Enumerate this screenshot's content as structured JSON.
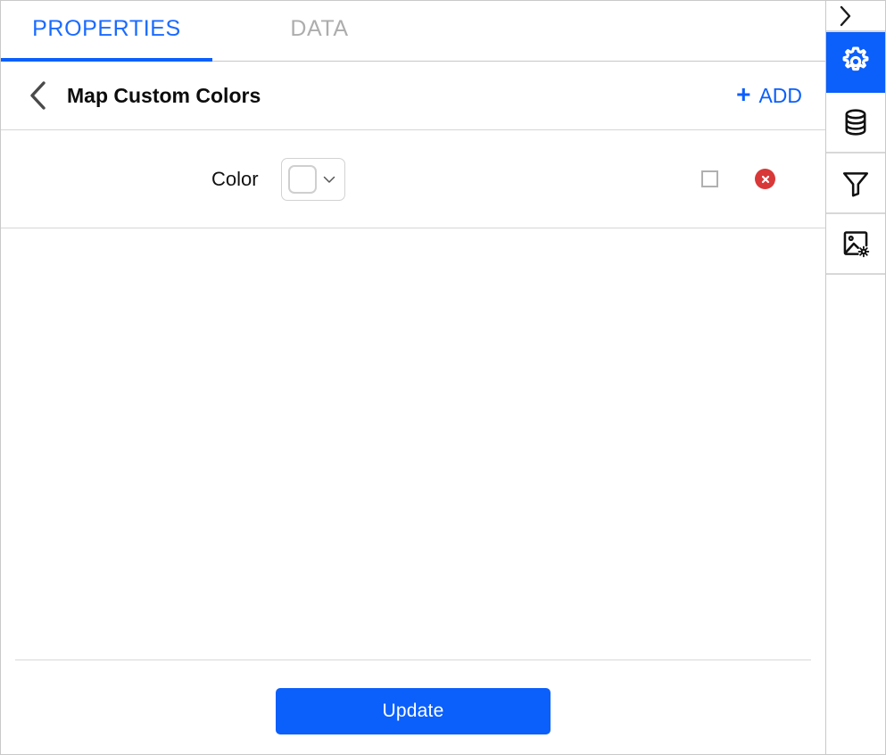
{
  "tabs": [
    {
      "label": "PROPERTIES",
      "active": true
    },
    {
      "label": "DATA",
      "active": false
    }
  ],
  "header": {
    "back_icon": "chevron-left-icon",
    "title": "Map Custom Colors",
    "add_label": "ADD",
    "add_plus": "+"
  },
  "rows": [
    {
      "label": "Color",
      "swatch_value": "#ffffff",
      "dropdown_icon": "chevron-down-icon",
      "checked": false,
      "delete_icon": "delete-circle-icon"
    }
  ],
  "footer": {
    "update_label": "Update"
  },
  "rail": {
    "items": [
      {
        "icon": "chevron-right-icon",
        "name": "expand-panel",
        "active": false
      },
      {
        "icon": "gear-icon",
        "name": "settings",
        "active": true
      },
      {
        "icon": "database-icon",
        "name": "data-source",
        "active": false
      },
      {
        "icon": "filter-funnel-icon",
        "name": "filter",
        "active": false
      },
      {
        "icon": "image-settings-icon",
        "name": "image-settings",
        "active": false
      }
    ]
  },
  "colors": {
    "accent_blue": "#0b5ffb",
    "tab_active_text": "#1a6bff",
    "tab_inactive_text": "#adadad",
    "delete_red": "#d93838",
    "border_gray": "#d6d6d6"
  }
}
